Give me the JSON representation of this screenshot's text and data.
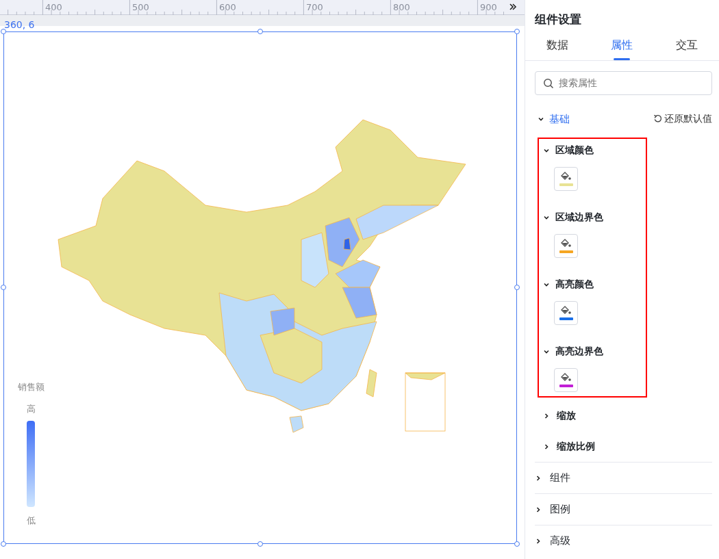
{
  "ruler": {
    "labels": [
      "400",
      "500",
      "600",
      "700",
      "800",
      "900"
    ]
  },
  "canvas": {
    "position": "360, 6"
  },
  "legend": {
    "title": "销售额",
    "high": "高",
    "low": "低"
  },
  "panel": {
    "title": "组件设置",
    "tabs": [
      {
        "label": "数据",
        "selected": false
      },
      {
        "label": "属性",
        "selected": true
      },
      {
        "label": "交互",
        "selected": false
      }
    ],
    "search": {
      "placeholder": "搜索属性"
    },
    "section": {
      "label": "基础",
      "expanded": true,
      "reset": "还原默认值"
    },
    "color_groups": [
      {
        "label": "区域颜色",
        "expanded": true,
        "color": "#e8e294"
      },
      {
        "label": "区域边界色",
        "expanded": true,
        "color": "#f5a623"
      },
      {
        "label": "高亮颜色",
        "expanded": true,
        "color": "#1a6fe8"
      },
      {
        "label": "高亮边界色",
        "expanded": true,
        "color": "#c21fd6"
      }
    ],
    "sub_items": [
      {
        "label": "缩放",
        "expanded": false
      },
      {
        "label": "缩放比例",
        "expanded": false
      }
    ],
    "sections": [
      {
        "label": "组件",
        "expanded": false
      },
      {
        "label": "图例",
        "expanded": false
      },
      {
        "label": "高级",
        "expanded": false
      }
    ]
  }
}
